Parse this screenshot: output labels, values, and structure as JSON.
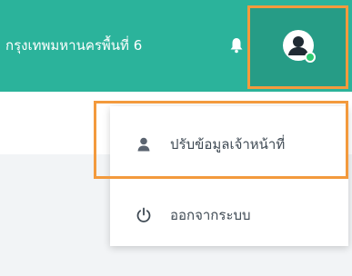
{
  "header": {
    "title": "กรุงเทพมหานครพื้นที่ 6",
    "bell_icon": "bell-icon",
    "avatar_icon": "user-avatar-icon"
  },
  "dropdown": {
    "items": [
      {
        "label": "ปรับข้อมูลเจ้าหน้าที่",
        "icon": "user-icon"
      },
      {
        "label": "ออกจากระบบ",
        "icon": "power-icon"
      }
    ]
  },
  "colors": {
    "header_bg": "#2bb39b",
    "user_area_bg": "#269c86",
    "highlight": "#f39a3d",
    "online_dot": "#2ecc71",
    "text": "#3f4a54"
  }
}
